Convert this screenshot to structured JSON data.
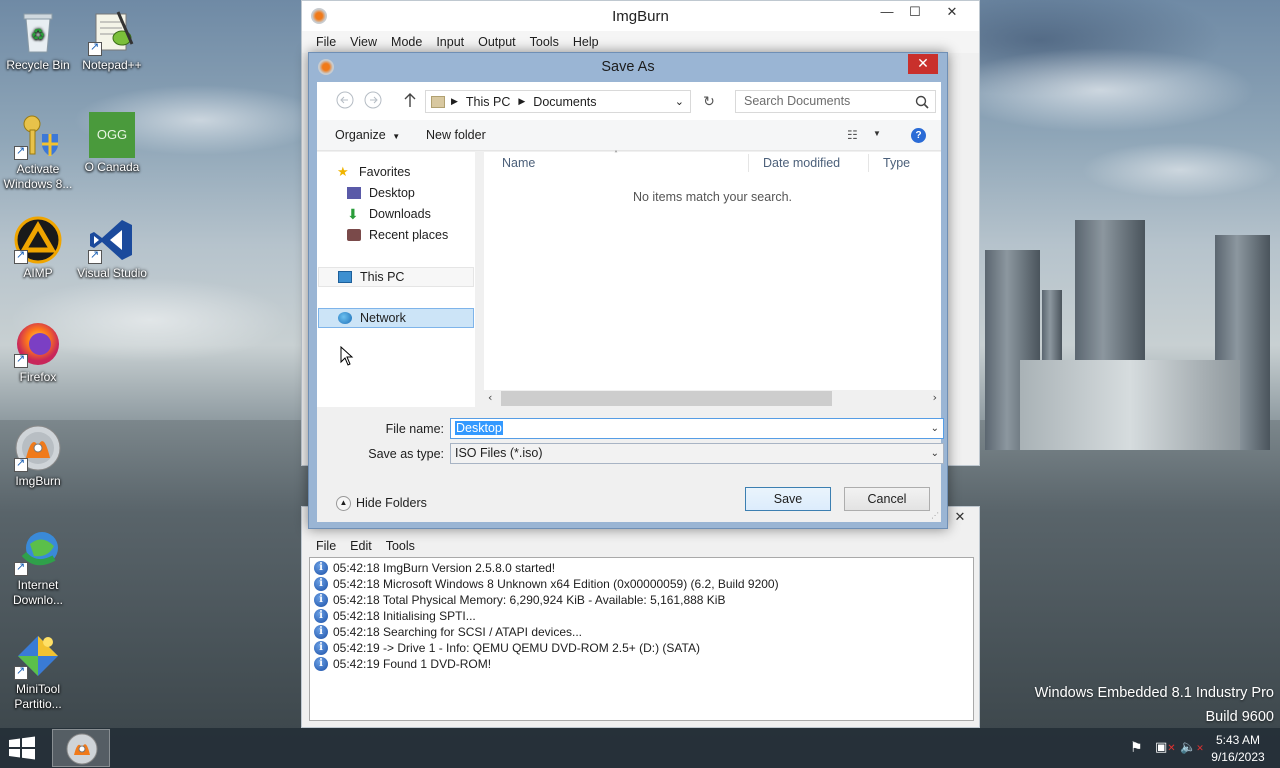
{
  "desktop": {
    "icons": [
      {
        "label": "Recycle Bin"
      },
      {
        "label": "Notepad++"
      },
      {
        "label": "Activate Windows 8..."
      },
      {
        "label": "O Canada"
      },
      {
        "label": "AIMP"
      },
      {
        "label": "Visual Studio"
      },
      {
        "label": "Firefox"
      },
      {
        "label": "ImgBurn"
      },
      {
        "label": "Internet Downlo..."
      },
      {
        "label": "MiniTool Partitio..."
      }
    ],
    "ogg_text": "OGG",
    "watermark": {
      "line1": "Windows Embedded 8.1 Industry Pro",
      "line2": "Build 9600"
    }
  },
  "imgburn": {
    "title": "ImgBurn",
    "menu": [
      "File",
      "View",
      "Mode",
      "Input",
      "Output",
      "Tools",
      "Help"
    ]
  },
  "log_window": {
    "menu": [
      "File",
      "Edit",
      "Tools"
    ],
    "lines": [
      "05:42:18 ImgBurn Version 2.5.8.0 started!",
      "05:42:18 Microsoft Windows 8 Unknown x64 Edition (0x00000059) (6.2, Build 9200)",
      "05:42:18 Total Physical Memory: 6,290,924 KiB  -  Available: 5,161,888 KiB",
      "05:42:18 Initialising SPTI...",
      "05:42:18 Searching for SCSI / ATAPI devices...",
      "05:42:19 -> Drive 1 - Info: QEMU QEMU DVD-ROM 2.5+ (D:) (SATA)",
      "05:42:19 Found 1 DVD-ROM!"
    ]
  },
  "save_dialog": {
    "title": "Save As",
    "breadcrumb": [
      "This PC",
      "Documents"
    ],
    "search_placeholder": "Search Documents",
    "organize_label": "Organize",
    "new_folder_label": "New folder",
    "nav": {
      "favorites": "Favorites",
      "desktop": "Desktop",
      "downloads": "Downloads",
      "recent": "Recent places",
      "this_pc": "This PC",
      "network": "Network"
    },
    "columns": [
      "Name",
      "Date modified",
      "Type"
    ],
    "empty_message": "No items match your search.",
    "file_name_label": "File name:",
    "file_name_value": "Desktop",
    "save_type_label": "Save as type:",
    "save_type_value": "ISO Files (*.iso)",
    "hide_folders_label": "Hide Folders",
    "save_label": "Save",
    "cancel_label": "Cancel"
  },
  "taskbar": {
    "time": "5:43 AM",
    "date": "9/16/2023"
  }
}
